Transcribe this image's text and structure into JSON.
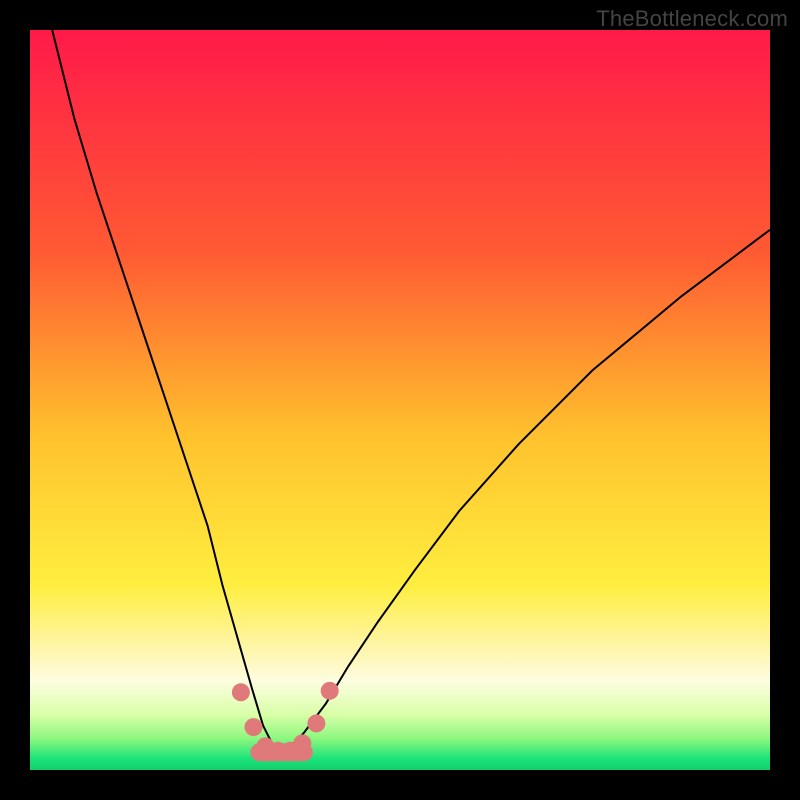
{
  "watermark": "TheBottleneck.com",
  "chart_data": {
    "type": "line",
    "title": "",
    "xlabel": "",
    "ylabel": "",
    "xlim": [
      0,
      100
    ],
    "ylim": [
      0,
      100
    ],
    "grid": false,
    "legend": false,
    "background_gradient": {
      "stops": [
        {
          "offset": 0.0,
          "color": "#ff1a49"
        },
        {
          "offset": 0.3,
          "color": "#ff5a33"
        },
        {
          "offset": 0.55,
          "color": "#ffc22d"
        },
        {
          "offset": 0.75,
          "color": "#ffee3f"
        },
        {
          "offset": 0.84,
          "color": "#fff6b0"
        },
        {
          "offset": 0.88,
          "color": "#fdfde0"
        },
        {
          "offset": 0.925,
          "color": "#d9ffa8"
        },
        {
          "offset": 0.958,
          "color": "#8bf77e"
        },
        {
          "offset": 0.985,
          "color": "#19e37a"
        },
        {
          "offset": 1.0,
          "color": "#15cf6c"
        }
      ]
    },
    "series": [
      {
        "name": "bottleneck-curve",
        "stroke": "#000000",
        "stroke_width": 2,
        "x": [
          3,
          6,
          9,
          12,
          15,
          18,
          21,
          24,
          26,
          28,
          30,
          31.5,
          33,
          35,
          37,
          40,
          43,
          47,
          52,
          58,
          66,
          76,
          88,
          100
        ],
        "values": [
          100,
          88,
          78,
          69,
          60,
          51,
          42,
          33,
          25,
          18,
          11,
          6,
          3,
          3,
          5,
          9,
          14,
          20,
          27,
          35,
          44,
          54,
          64,
          73
        ]
      },
      {
        "name": "green-zone-markers",
        "type": "scatter",
        "marker_color": "#e07a7a",
        "marker_radius": 9,
        "x": [
          28.5,
          30.2,
          31.8,
          33.5,
          35.2,
          36.8,
          38.7,
          40.5
        ],
        "values": [
          10.5,
          5.8,
          3.2,
          2.6,
          2.6,
          3.6,
          6.3,
          10.7
        ]
      },
      {
        "name": "green-zone-bar",
        "type": "line",
        "stroke": "#e07a7a",
        "stroke_width": 18,
        "linecap": "round",
        "x": [
          31.0,
          37.0
        ],
        "values": [
          2.4,
          2.4
        ]
      }
    ]
  }
}
